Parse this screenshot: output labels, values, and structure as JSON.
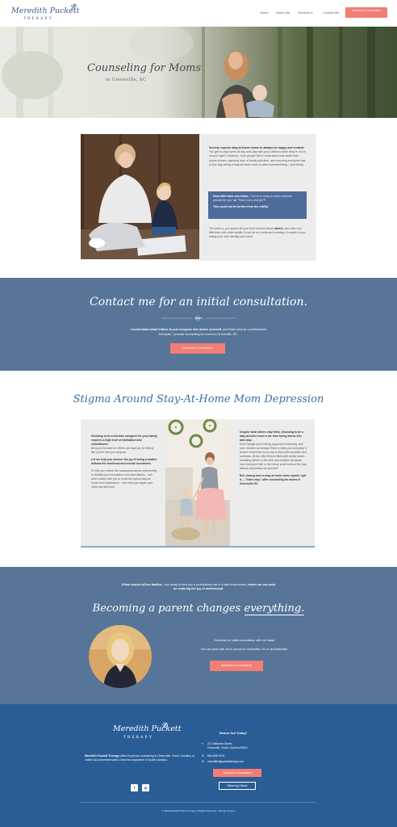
{
  "header": {
    "logo_title": "Meredith Puckett",
    "logo_sub": "THERAPY",
    "nav": [
      "Home",
      "About Me",
      "Services",
      "Contact Me"
    ],
    "cta": "Schedule A Consultation"
  },
  "hero": {
    "title": "Counseling for Moms",
    "subtitle": "in Greenville, SC"
  },
  "intro": {
    "p1_bold": "Society expects stay-at-home moms to always be happy and content.",
    "p1": "You get to stay home all day and play with your children when they're not in school, right? However, most people fail to understand that aside from house chores, planning tons of family activities, and ensuring everyone has a nice day, being a stay-at-home mom is often overwhelming... and lonely.",
    "quote_lead": "How often have you heard,",
    "quote_1": "\"You're so lucky to have someone provide for you\"",
    "quote_or": "or",
    "quote_2": "\"That's not a real job\"",
    "quote_q": "?",
    "quote_end": "This could not be further from the reality!",
    "p2_lead": "The truth is, you spend all your time worried about",
    "p2_bold": "others,",
    "p2": "and often too little time with other adults. It can be so lonely and isolating. It results in you losing your own identity and voice."
  },
  "contact_band": {
    "title": "Contact me for an initial consultation.",
    "text_bold": "I understand what it takes to put everyone else above yourself,",
    "text": "and that's why as a professional therapist, I provide counseling for moms in Greenville, SC.",
    "button": "Schedule A Consultation"
  },
  "stigma": {
    "title": "Stigma Around Stay-At-Home Mom Depression",
    "left_bold1": "Deciding to be a full-time caregiver for your family requires a high level of dedication and commitment.",
    "left_p1": "Being so focused on others can lead you to feeling like you've lost your purpose.",
    "left_bold2": "Let me help you recover the joy of being a mother without the emotional and mental overwhelm.",
    "left_p2": "I'll help you relieve the subsequent stress and anxiety to solidify your boundaries and expectations. I will work closely with you to avoid the typical stay-at-home mom depression. I can help you regain your voice and self-trust.",
    "right_bold1": "Despite what others may think, choosing to be a stay-at-home mom is far from being stress-free and easy.",
    "right_p1": "Even though you're being supported financially, and your children are always there to keep you company, it doesn't mean that every day is filled with sunshine and rainbows. All too often they're filled with snotty noses, mounting dishes in the sink, and endless demands from everyone else in the house at all hours of the day without any breaks for yourself!",
    "right_bold2": "But, having been a stay at home mom myself, I get it — That's why I offer counseling for moms in Greenville SC."
  },
  "band2": {
    "text_bold1": "If that sounds all too familiar,",
    "text_1": "I am ready to lend you a professional ear in a safe environment,",
    "text_bold2": "where we can work on restoring the joy of motherhood.",
    "title_main": "Becoming a parent changes",
    "title_em": "everything.",
    "schedule_text": "Schedule an initial consultation with me today.",
    "meet_text": "You can work with me in person in Greenville, SC or via telehealth.",
    "button": "Schedule A Consultation"
  },
  "footer": {
    "logo_title": "Meredith Puckett",
    "logo_sub": "THERAPY",
    "desc_bold": "Meredith Puckett Therapy",
    "desc": "offers in-person counseling in Greenville, South Carolina, or online via convenient video chat from anywhere in South Carolina.",
    "reach": "Reach Out Today!",
    "addr1": "212 Wildwest Street,",
    "addr2": "Greenville, South Carolina 29601",
    "phone": "864-608-0219",
    "email": "meredith@puckettherapy.com",
    "sched_btn": "Schedule A Consultation",
    "ret_btn": "Returning Clients",
    "social": [
      "f",
      "◎"
    ],
    "copyright": "© 2023 Meredith Puckett Therapy. All Rights Reserved. | Site By: Phoenix"
  },
  "colors": {
    "accent": "#f27d74",
    "band": "#567599",
    "footer": "#2a5d96",
    "title_blue": "#3a6ea5"
  }
}
